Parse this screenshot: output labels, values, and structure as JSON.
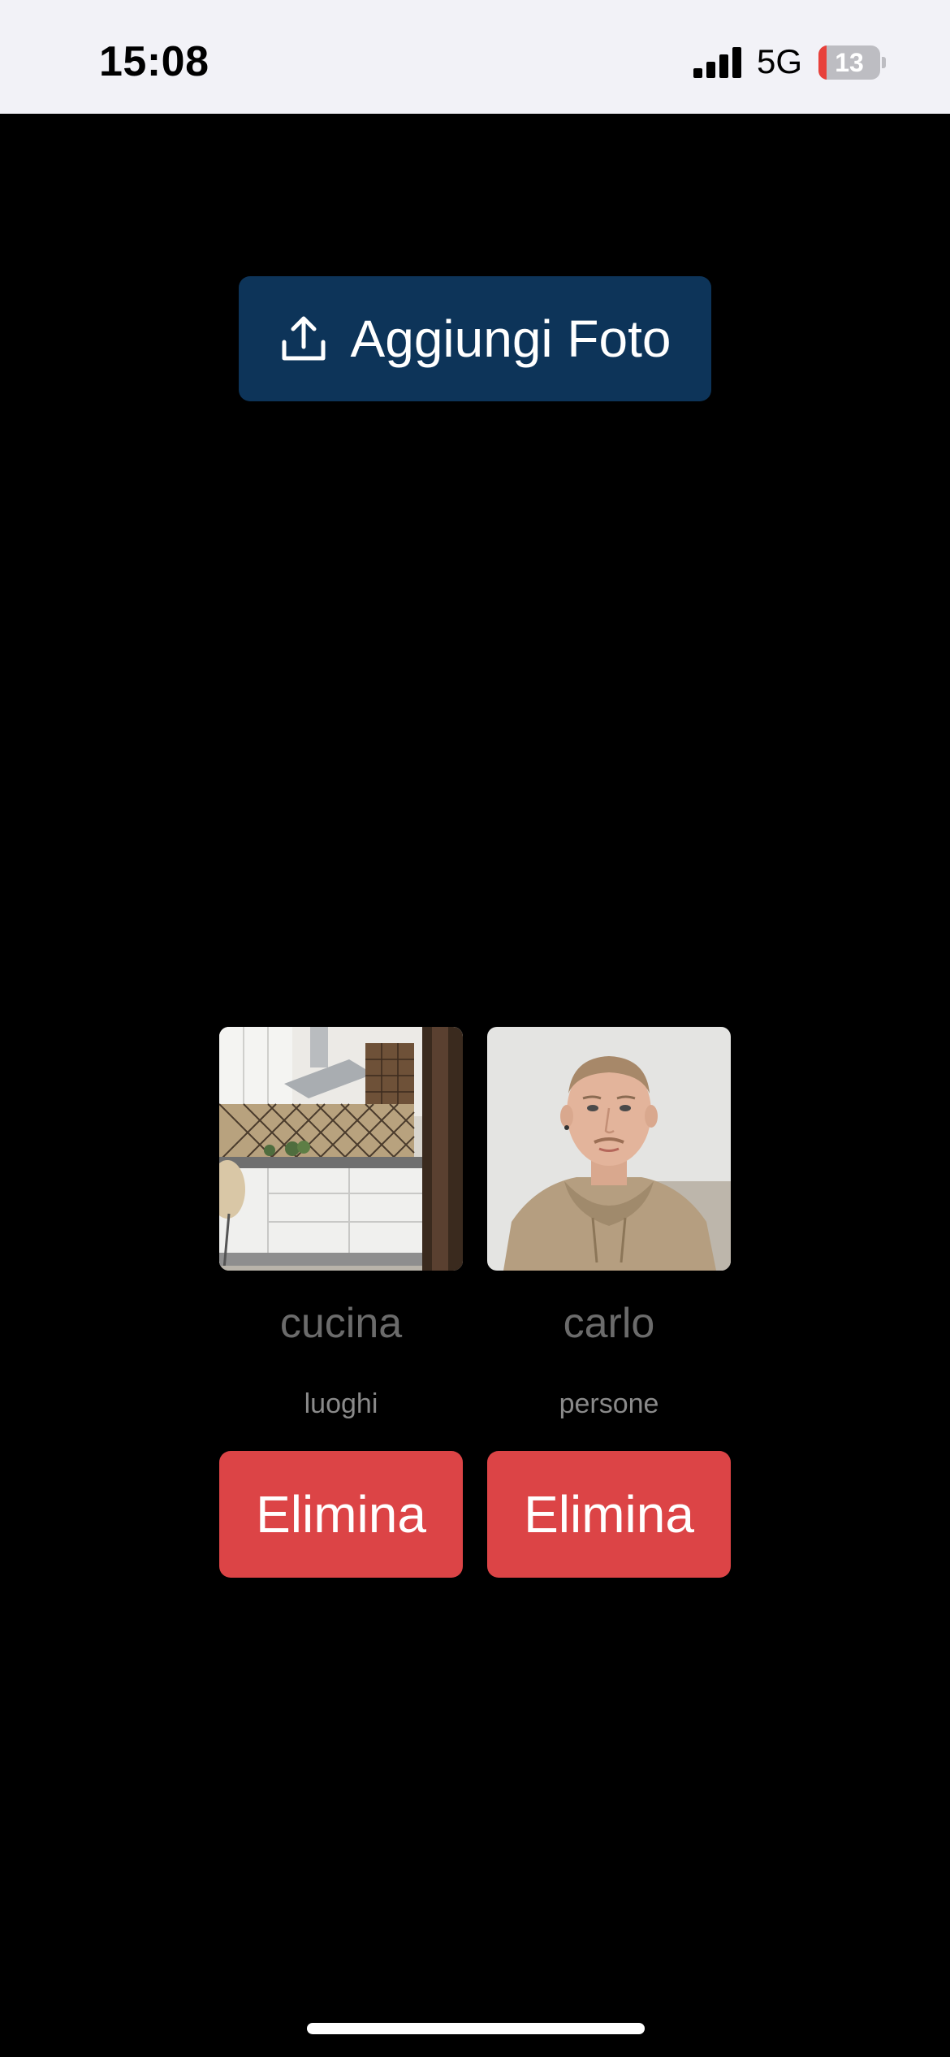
{
  "status_bar": {
    "time": "15:08",
    "network": "5G",
    "battery_level": "13",
    "battery_fraction": 0.13,
    "signal_icon": "cellular-signal-icon",
    "battery_icon": "battery-low-icon"
  },
  "actions": {
    "add_photo_label": "Aggiungi Foto",
    "add_photo_icon": "upload-icon"
  },
  "photos": [
    {
      "name": "cucina",
      "category": "luoghi",
      "delete_label": "Elimina",
      "image": "kitchen-photo"
    },
    {
      "name": "carlo",
      "category": "persone",
      "delete_label": "Elimina",
      "image": "portrait-photo"
    }
  ],
  "colors": {
    "background": "#000000",
    "primary_button": "#0d3459",
    "danger_button": "#dc4446",
    "status_bar": "#f2f2f7",
    "battery_low": "#e8413b"
  }
}
